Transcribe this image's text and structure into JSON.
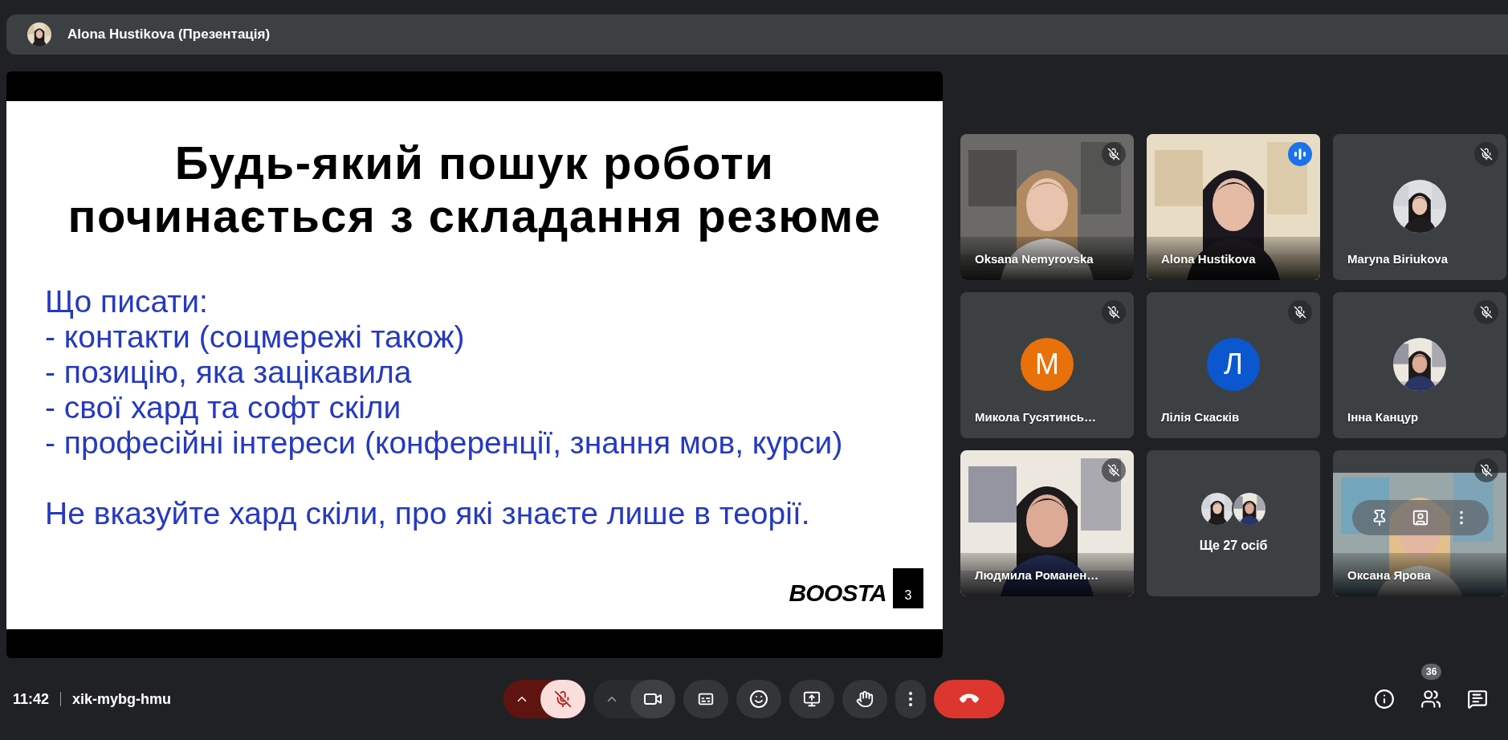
{
  "header": {
    "title": "Alona Hustikova (Презентація)"
  },
  "slide": {
    "heading": [
      "Будь-який пошук роботи",
      "починається з складання резюме"
    ],
    "body": [
      "Що писати:",
      "- контакти (соцмережі також)",
      "- позицію, яка зацікавила",
      "- свої хард та софт скіли",
      "- професійні інтереси (конференції, знання мов, курси)"
    ],
    "note": "Не вказуйте хард скіли, про які знаєте лише в теорії.",
    "logo": "BOOSTA",
    "logo_badge": "3"
  },
  "tiles": [
    {
      "kind": "video",
      "name": "Oksana Nemyrovska",
      "muted": true,
      "speaking": false,
      "hovered": false
    },
    {
      "kind": "video",
      "name": "Alona Hustikova",
      "muted": false,
      "speaking": true,
      "hovered": false
    },
    {
      "name": "Maryna Biriukova",
      "muted": true,
      "speaking": false,
      "hovered": false
    },
    {
      "kind": "initial",
      "name": "Микола Гусятинсь…",
      "initial": "М",
      "color": "#e8710a",
      "muted": true,
      "speaking": false,
      "hovered": false
    },
    {
      "kind": "initial",
      "name": "Лілія Скасків",
      "initial": "Л",
      "color": "#0b57d0",
      "muted": true,
      "speaking": false,
      "hovered": false
    },
    {
      "name": "Інна Канцур",
      "muted": true,
      "speaking": false,
      "hovered": false
    },
    {
      "kind": "video",
      "name": "Людмила Романен…",
      "muted": true,
      "speaking": false,
      "hovered": false
    },
    {
      "kind": "more",
      "label": "Ще 27 осіб"
    },
    {
      "kind": "video",
      "name": "Оксана Ярова",
      "muted": true,
      "speaking": false,
      "hovered": true
    }
  ],
  "footer": {
    "time": "11:42",
    "meeting_code": "xik-mybg-hmu",
    "controls": [
      {
        "kind": "mic",
        "muted": true
      },
      {
        "kind": "camera"
      },
      {
        "kind": "captions"
      },
      {
        "kind": "reactions"
      },
      {
        "kind": "present"
      },
      {
        "kind": "hand"
      },
      {
        "kind": "more"
      },
      {
        "kind": "leave"
      }
    ],
    "side_buttons": [
      {
        "kind": "info"
      },
      {
        "kind": "people",
        "badge": "36"
      },
      {
        "kind": "chat"
      }
    ]
  }
}
